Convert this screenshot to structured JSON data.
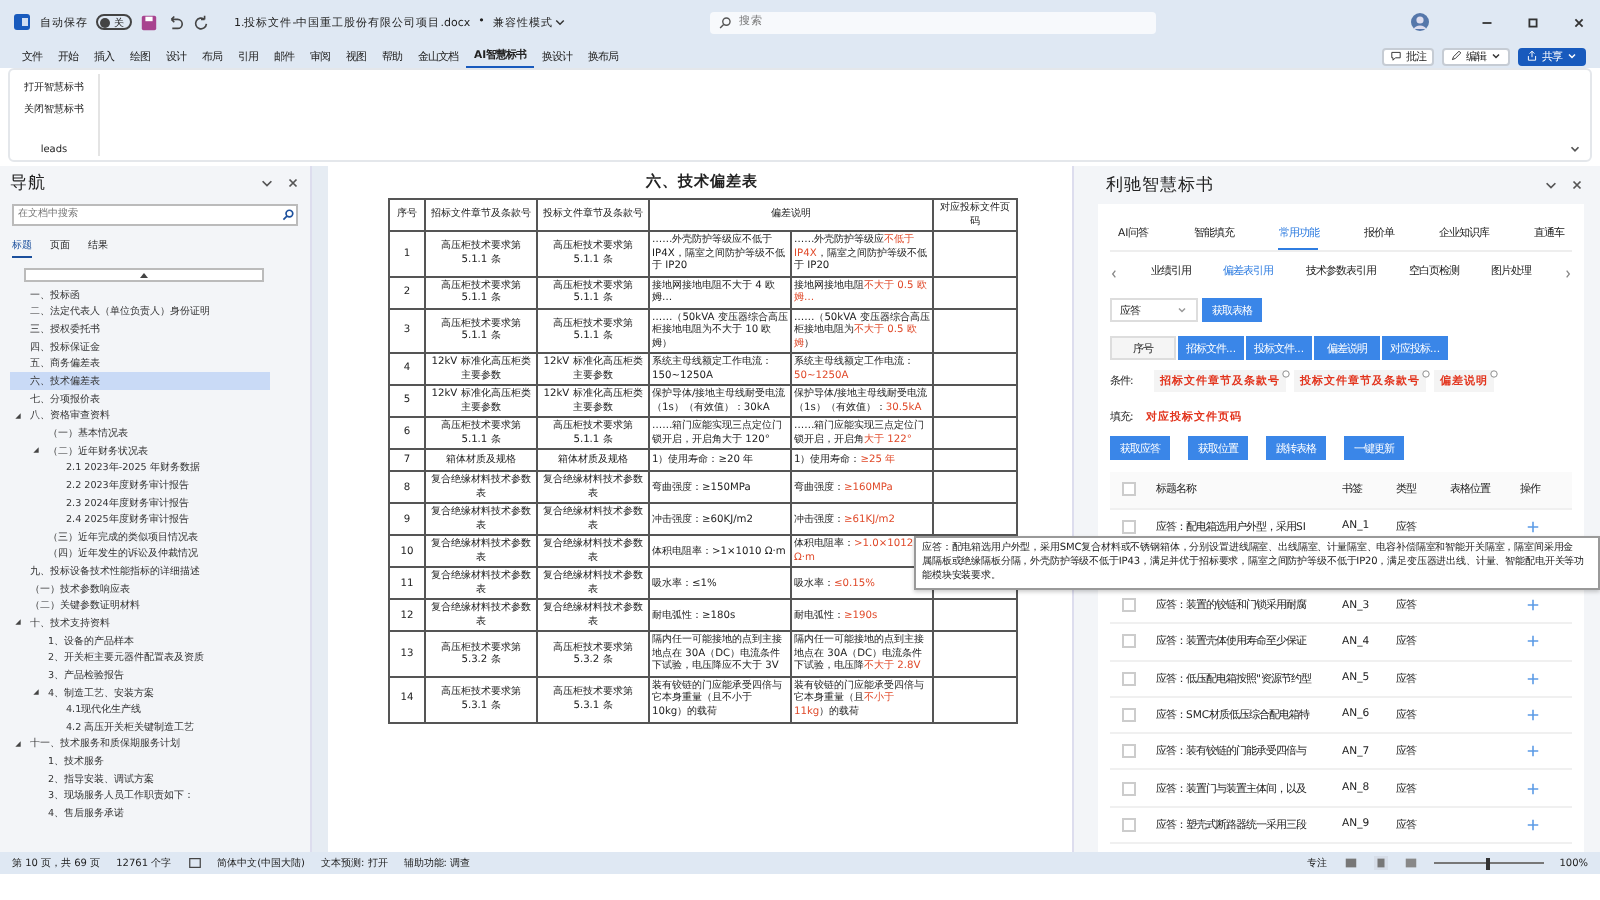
{
  "title_bar": {
    "autosave_label": "自动保存",
    "autosave_toggle": {
      "label": "关",
      "on": false
    },
    "document_title": "1.投标文件-中国重工股份有限公司项目.docx",
    "separator": "•",
    "mode": "兼容性模式",
    "search": {
      "placeholder": "搜索"
    }
  },
  "ribbon": {
    "tabs": [
      {
        "label": "文件",
        "selected": false
      },
      {
        "label": "开始",
        "selected": false
      },
      {
        "label": "插入",
        "selected": false
      },
      {
        "label": "绘图",
        "selected": false
      },
      {
        "label": "设计",
        "selected": false
      },
      {
        "label": "布局",
        "selected": false
      },
      {
        "label": "引用",
        "selected": false
      },
      {
        "label": "邮件",
        "selected": false
      },
      {
        "label": "审阅",
        "selected": false
      },
      {
        "label": "视图",
        "selected": false
      },
      {
        "label": "帮助",
        "selected": false
      },
      {
        "label": "金山文档",
        "selected": false
      },
      {
        "label": "AI智慧标书",
        "selected": true
      },
      {
        "label": "换设计",
        "selected": false
      },
      {
        "label": "换布局",
        "selected": false
      }
    ],
    "buttons": [
      "打开智慧标书",
      "关闭智慧标书"
    ],
    "group_label": "leads",
    "actions": [
      {
        "label": "批注",
        "kind": "comment"
      },
      {
        "label": "编辑",
        "kind": "edit"
      },
      {
        "label": "共享",
        "kind": "share"
      }
    ]
  },
  "navigation": {
    "title": "导航",
    "search": {
      "placeholder": "在文档中搜索"
    },
    "tabs": [
      {
        "label": "标题",
        "selected": true
      },
      {
        "label": "页面",
        "selected": false
      },
      {
        "label": "结果",
        "selected": false
      }
    ],
    "items": [
      {
        "label": "一、投标函",
        "selected": false
      },
      {
        "label": "二、法定代表人（单位负责人）身份证明",
        "selected": false
      },
      {
        "label": "三、授权委托书",
        "selected": false
      },
      {
        "label": "四、投标保证金",
        "selected": false
      },
      {
        "label": "五、商务偏差表",
        "selected": false
      },
      {
        "label": "六、技术偏差表",
        "selected": true
      },
      {
        "label": "七、分项报价表",
        "selected": false
      },
      {
        "label": "八、资格审查资料",
        "selected": false,
        "expanded": true,
        "children": [
          {
            "label": "（一）基本情况表",
            "selected": false
          },
          {
            "label": "（二）近年财务状况表",
            "selected": false,
            "expanded": true,
            "children": [
              {
                "label": "2.1   2023年-2025 年财务数据",
                "selected": false
              },
              {
                "label": "2.2   2023年度财务审计报告",
                "selected": false
              },
              {
                "label": "2.3   2024年度财务审计报告",
                "selected": false
              },
              {
                "label": "2.4   2025年度财务审计报告",
                "selected": false
              }
            ]
          },
          {
            "label": "（三）近年完成的类似项目情况表",
            "selected": false
          },
          {
            "label": "（四）近年发生的诉讼及仲裁情况",
            "selected": false
          }
        ]
      },
      {
        "label": "九、投标设备技术性能指标的详细描述",
        "selected": false
      },
      {
        "label": "（一）技术参数响应表",
        "selected": false
      },
      {
        "label": "（二）关键参数证明材料",
        "selected": false
      },
      {
        "label": "十、技术支持资料",
        "selected": false,
        "expanded": true,
        "children": [
          {
            "label": "1、设备的产品样本",
            "selected": false
          },
          {
            "label": "2、开关柜主要元器件配置表及资质",
            "selected": false
          },
          {
            "label": "3、产品检验报告",
            "selected": false
          },
          {
            "label": "4、制造工艺、安装方案",
            "selected": false,
            "expanded": true,
            "children": [
              {
                "label": "4.1现代化生产线",
                "selected": false
              },
              {
                "label": "4.2 高压开关柜关键制造工艺",
                "selected": false
              }
            ]
          }
        ]
      },
      {
        "label": "十一、技术服务和质保期服务计划",
        "selected": false,
        "expanded": true,
        "children": [
          {
            "label": "1、技术服务",
            "selected": false
          },
          {
            "label": "2、指导安装、调试方案",
            "selected": false
          },
          {
            "label": "3、现场服务人员工作职责如下：",
            "selected": false
          },
          {
            "label": "4、售后服务承诺",
            "selected": false
          }
        ]
      }
    ]
  },
  "document": {
    "heading": "六、技术偏差表",
    "table": {
      "columns": [
        "序号",
        "招标文件章节及条款号",
        "投标文件章节及条款号",
        "偏差说明",
        "对应投标文件页码"
      ],
      "rows": [
        {
          "no": "1",
          "tender_clause": "高压柜技术要求第 5.1.1 条",
          "bid_clause": "高压柜技术要求第 5.1.1 条",
          "requirement": "……外壳防护等级应不低于 IP4X，隔室之间防护等级不低于 IP20",
          "response": [
            {
              "text": "……外壳防护等级应",
              "highlighted": false
            },
            {
              "text": "不低于 IP4X",
              "highlighted": true
            },
            {
              "text": "，隔室之间防护等级不低于 IP20",
              "highlighted": false
            }
          ]
        },
        {
          "no": "2",
          "tender_clause": "高压柜技术要求第 5.1.1 条",
          "bid_clause": "高压柜技术要求第 5.1.1 条",
          "requirement": "接地网接地电阻不大于 4 欧姆…",
          "response": [
            {
              "text": "接地网接地电阻",
              "highlighted": false
            },
            {
              "text": "不大于 0.5 欧姆…",
              "highlighted": true
            }
          ]
        },
        {
          "no": "3",
          "tender_clause": "高压柜技术要求第 5.1.1 条",
          "bid_clause": "高压柜技术要求第 5.1.1 条",
          "requirement": "……（50kVA 变压器综合高压柜接地电阻为不大于 10 欧姆）",
          "response": [
            {
              "text": "……（50kVA 变压器综合高压柜接地电阻为",
              "highlighted": false
            },
            {
              "text": "不大于 0.5 欧姆",
              "highlighted": true
            },
            {
              "text": "）",
              "highlighted": false
            }
          ]
        },
        {
          "no": "4",
          "tender_clause": "12kV 标准化高压柜类主要参数",
          "bid_clause": "12kV 标准化高压柜类主要参数",
          "requirement": "系统主母线额定工作电流：150~1250A",
          "response": [
            {
              "text": "系统主母线额定工作电流：",
              "highlighted": false
            },
            {
              "text": "50~1250A",
              "highlighted": true
            }
          ]
        },
        {
          "no": "5",
          "tender_clause": "12kV 标准化高压柜类主要参数",
          "bid_clause": "12kV 标准化高压柜类主要参数",
          "requirement": "保护导体/接地主母线耐受电流（1s）（有效值）：30kA",
          "response": [
            {
              "text": "保护导体/接地主母线耐受电流（1s）（有效值）：",
              "highlighted": false
            },
            {
              "text": "30.5kA",
              "highlighted": true
            }
          ]
        },
        {
          "no": "6",
          "tender_clause": "高压柜技术要求第 5.1.1 条",
          "bid_clause": "高压柜技术要求第 5.1.1 条",
          "requirement": "……箱门应能实现三点定位门锁开启，开启角大于 120°",
          "response": [
            {
              "text": "……箱门应能实现三点定位门锁开启，开启角",
              "highlighted": false
            },
            {
              "text": "大于 122°",
              "highlighted": true
            }
          ]
        },
        {
          "no": "7",
          "tender_clause": "箱体材质及规格",
          "bid_clause": "箱体材质及规格",
          "requirement": "1）使用寿命：≥20 年",
          "response": [
            {
              "text": "1）使用寿命：",
              "highlighted": false
            },
            {
              "text": "≥25 年",
              "highlighted": true
            }
          ]
        },
        {
          "no": "8",
          "tender_clause": "复合绝缘材料技术参数表",
          "bid_clause": "复合绝缘材料技术参数表",
          "requirement": "弯曲强度：≥150MPa",
          "response": [
            {
              "text": "弯曲强度：",
              "highlighted": false
            },
            {
              "text": "≥160MPa",
              "highlighted": true
            }
          ]
        },
        {
          "no": "9",
          "tender_clause": "复合绝缘材料技术参数表",
          "bid_clause": "复合绝缘材料技术参数表",
          "requirement": "冲击强度：≥60KJ/m2",
          "response": [
            {
              "text": "冲击强度：",
              "highlighted": false
            },
            {
              "text": "≥61KJ/m2",
              "highlighted": true
            }
          ]
        },
        {
          "no": "10",
          "tender_clause": "复合绝缘材料技术参数表",
          "bid_clause": "复合绝缘材料技术参数表",
          "requirement": "体积电阻率：>1×1010 Ω·m",
          "response": [
            {
              "text": "体积电阻率：",
              "highlighted": false
            },
            {
              "text": ">1.0×1012 Ω·m",
              "highlighted": true
            }
          ]
        },
        {
          "no": "11",
          "tender_clause": "复合绝缘材料技术参数表",
          "bid_clause": "复合绝缘材料技术参数表",
          "requirement": "吸水率：≤1%",
          "response": [
            {
              "text": "吸水率：",
              "highlighted": false
            },
            {
              "text": "≤0.15%",
              "highlighted": true
            }
          ]
        },
        {
          "no": "12",
          "tender_clause": "复合绝缘材料技术参数表",
          "bid_clause": "复合绝缘材料技术参数表",
          "requirement": "耐电弧性：≥180s",
          "response": [
            {
              "text": "耐电弧性：",
              "highlighted": false
            },
            {
              "text": "≥190s",
              "highlighted": true
            }
          ]
        },
        {
          "no": "13",
          "tender_clause": "高压柜技术要求第 5.3.2 条",
          "bid_clause": "高压柜技术要求第 5.3.2 条",
          "requirement": "隔内任一可能接地的点到主接地点在 30A（DC）电流条件下试验，电压降应不大于 3V",
          "response": [
            {
              "text": "隔内任一可能接地的点到主接地点在 30A（DC）电流条件下试验，电压降",
              "highlighted": false
            },
            {
              "text": "不大于 2.8V",
              "highlighted": true
            }
          ]
        },
        {
          "no": "14",
          "tender_clause": "高压柜技术要求第 5.3.1 条",
          "bid_clause": "高压柜技术要求第 5.3.1 条",
          "requirement": "装有铰链的门应能承受四倍与它本身重量（且不小于 10kg）的载荷",
          "response": [
            {
              "text": "装有铰链的门应能承受四倍与它本身重量（且",
              "highlighted": false
            },
            {
              "text": "不小于 11kg",
              "highlighted": true
            },
            {
              "text": "）的载荷",
              "highlighted": false
            }
          ]
        }
      ]
    }
  },
  "tooltip": {
    "lines": [
      "应答：配电箱选用户外型，采用SMC复合材料或不锈钢箱体，分别设置进线隔室、出线隔室、计量隔室、电容补偿隔室和智能开关隔室，隔室间采用金",
      "属隔板或绝缘隔板分隔，外壳防护等级不低于IP43，满足并优于招标要求，隔室之间防护等级不低于IP20，满足变压器进出线、计量、智能配电开关等功",
      "能模块安装要求。"
    ]
  },
  "side_panel": {
    "title": "利驰智慧标书",
    "tabs": [
      {
        "label": "AI问答",
        "selected": false
      },
      {
        "label": "智能填充",
        "selected": false
      },
      {
        "label": "常用功能",
        "selected": true
      },
      {
        "label": "报价单",
        "selected": false
      },
      {
        "label": "企业知识库",
        "selected": false
      },
      {
        "label": "直通车",
        "selected": false
      }
    ],
    "subtabs": [
      {
        "label": "业绩引用",
        "selected": false
      },
      {
        "label": "偏差表引用",
        "selected": true
      },
      {
        "label": "技术参数表引用",
        "selected": false
      },
      {
        "label": "空白页检测",
        "selected": false
      },
      {
        "label": "图片处理",
        "selected": false
      }
    ],
    "select": {
      "value": "应答"
    },
    "fetch_button": "获取表格",
    "column_chips": [
      {
        "label": "序号",
        "selected": false
      },
      {
        "label": "招标文件...",
        "selected": true
      },
      {
        "label": "投标文件...",
        "selected": true
      },
      {
        "label": "偏差说明",
        "selected": true
      },
      {
        "label": "对应投标...",
        "selected": true
      }
    ],
    "condition_label": "条件:",
    "conditions": [
      "招标文件章节及条款号",
      "投标文件章节及条款号",
      "偏差说明"
    ],
    "fill_label": "填充:",
    "fill_value": "对应投标文件页码",
    "action_buttons": [
      "获取应答",
      "获取位置",
      "跳转表格",
      "一键更新"
    ],
    "table": {
      "select_all_checked": false,
      "columns": [
        "标题名称",
        "书签",
        "类型",
        "表格位置",
        "操作"
      ],
      "rows": [
        {
          "title": "应答：配电箱选用户外型，采用SI",
          "bookmark": "AN_1",
          "type": "应答",
          "checked": false
        },
        {
          "title": "应答：装置的铰链和门锁采用耐腐",
          "bookmark": "AN_3",
          "type": "应答",
          "checked": false
        },
        {
          "title": "应答：装置壳体使用寿命至少保证",
          "bookmark": "AN_4",
          "type": "应答",
          "checked": false
        },
        {
          "title": "应答：低压配电箱按照\"资源节约型",
          "bookmark": "AN_5",
          "type": "应答",
          "checked": false
        },
        {
          "title": "应答：SMC材质低压综合配电箱特",
          "bookmark": "AN_6",
          "type": "应答",
          "checked": false
        },
        {
          "title": "应答：装有铰链的门能承受四倍与",
          "bookmark": "AN_7",
          "type": "应答",
          "checked": false
        },
        {
          "title": "应答：装置门与装置主体间，以及",
          "bookmark": "AN_8",
          "type": "应答",
          "checked": false
        },
        {
          "title": "应答：塑壳式断路器统一采用三段",
          "bookmark": "AN_9",
          "type": "应答",
          "checked": false
        }
      ]
    }
  },
  "status_bar": {
    "page": "第 10 页，共 69 页",
    "words": "12761 个字",
    "language": "简体中文(中国大陆)",
    "text_prediction": "文本预测: 打开",
    "accessibility": "辅助功能: 调查",
    "focus": "专注",
    "zoom": {
      "level": 0.5,
      "reading": "100%"
    }
  }
}
